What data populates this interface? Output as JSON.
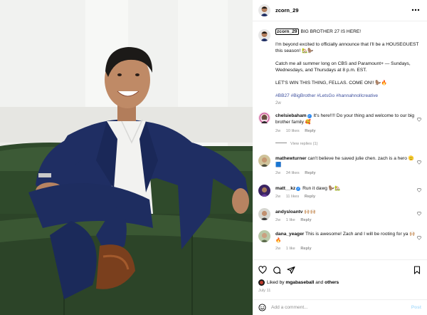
{
  "post": {
    "username": "zcorn_29",
    "caption": {
      "username": "zcorn_29",
      "line1": "BIG BROTHER 27 IS HERE!",
      "line2": "I'm beyond excited to officially announce that I'll be a HOUSEGUEST this season! 🏡🦫",
      "line3": "Catch me all summer long on CBS and Paramount+ — Sundays, Wednesdays, and Thursdays at 8 p.m. EST.",
      "line4": "LET'S WIN THIS THING, FELLAS. COME ON!! 🦫🔥",
      "hashtags": "#BB27 #BigBrother #LetsGo #hannahnollcreative",
      "time": "2w"
    },
    "comments": [
      {
        "username": "chelsiebaham",
        "verified": true,
        "text": "It's here!!!! Do your thing and welcome to our big brother family 🥰",
        "time": "2w",
        "likes": "10 likes",
        "reply": "Reply"
      },
      {
        "username": "mathewturner",
        "verified": false,
        "text": "can't believe he saved julie chen. zach is a hero 🫡🟦",
        "time": "2w",
        "likes": "34 likes",
        "reply": "Reply"
      },
      {
        "username": "matt__kz",
        "verified": true,
        "text": "Run it dawg 🦫🏡",
        "time": "2w",
        "likes": "11 likes",
        "reply": "Reply"
      },
      {
        "username": "andysloantv",
        "verified": false,
        "text": "🙌🏼🙌🏼",
        "time": "2w",
        "likes": "1 like",
        "reply": "Reply"
      },
      {
        "username": "dana_yeager",
        "verified": false,
        "text": "This is awesome! Zach and I will be rooting for ya 🙌🏼🔥",
        "time": "2w",
        "likes": "1 like",
        "reply": "Reply"
      }
    ],
    "view_replies": "View replies (1)",
    "liked_by": {
      "prefix": "Liked by",
      "user": "mgabaseball",
      "and": "and",
      "others": "others"
    },
    "date": "July 11",
    "add_comment": {
      "placeholder": "Add a comment...",
      "post_label": "Post"
    }
  },
  "icons": {
    "more": "more-horizontal-icon",
    "heart": "heart-icon",
    "comment": "comment-icon",
    "share": "share-icon",
    "bookmark": "bookmark-icon",
    "emoji": "emoji-icon"
  },
  "colors": {
    "hashtag": "#3d4f9e",
    "meta_gray": "#8e8e8e",
    "verified": "#2f8cf0",
    "post_button": "#b2dffc"
  }
}
